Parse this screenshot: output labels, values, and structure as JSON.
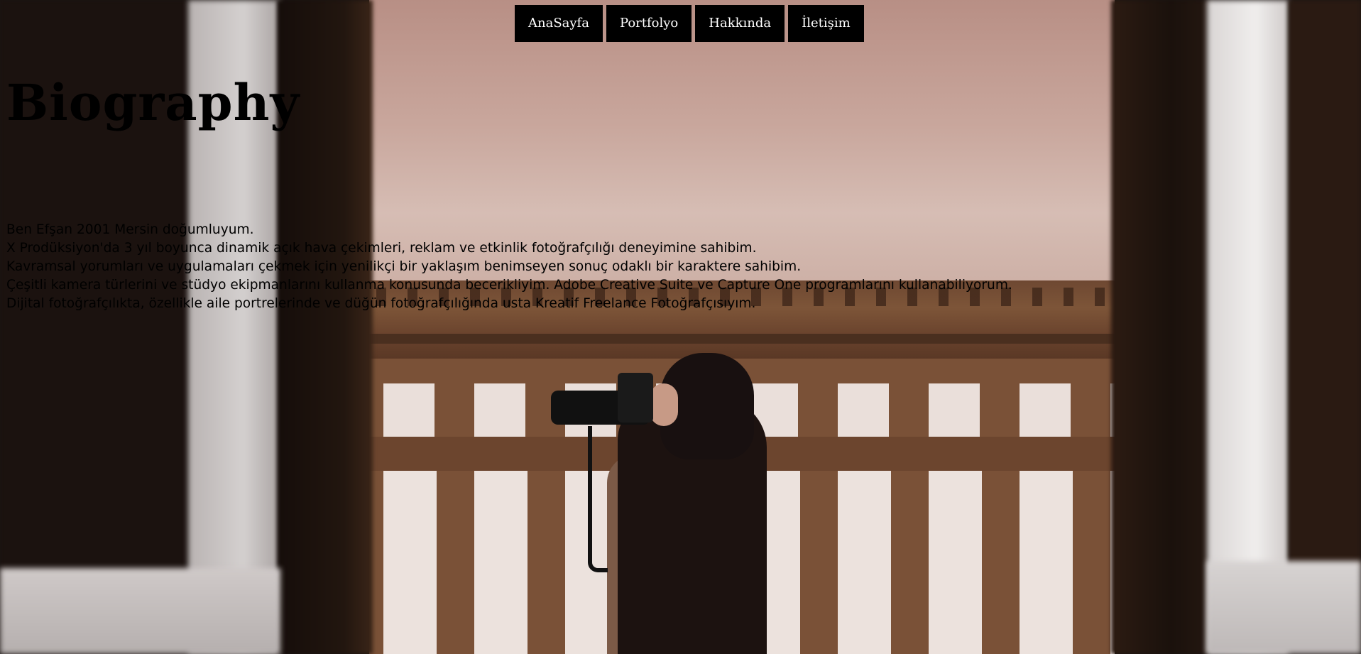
{
  "nav": {
    "items": [
      {
        "label": "AnaSayfa"
      },
      {
        "label": "Portfolyo"
      },
      {
        "label": "Hakkında"
      },
      {
        "label": "İletişim"
      }
    ]
  },
  "main": {
    "title": "Biography",
    "bio_lines": [
      "Ben Efşan 2001 Mersin doğumluyum.",
      "X Prodüksiyon'da 3 yıl boyunca dinamik açık hava çekimleri, reklam ve etkinlik fotoğrafçılığı deneyimine sahibim.",
      "Kavramsal yorumları ve uygulamaları çekmek için yenilikçi bir yaklaşım benimseyen sonuç odaklı bir karaktere sahibim.",
      "Çeşitli kamera türlerini ve stüdyo ekipmanlarını kullanma konusunda becerikliyim. Adobe Creative Suite ve Capture One programlarını kullanabiliyorum.",
      "Dijital fotoğrafçılıkta, özellikle aile portrelerinde ve düğün fotoğrafçılığında usta Kreatif Freelance Fotoğrafçısıyım."
    ]
  },
  "colors": {
    "nav_bg": "#000000",
    "nav_text": "#ffffff",
    "body_text": "#000000"
  }
}
